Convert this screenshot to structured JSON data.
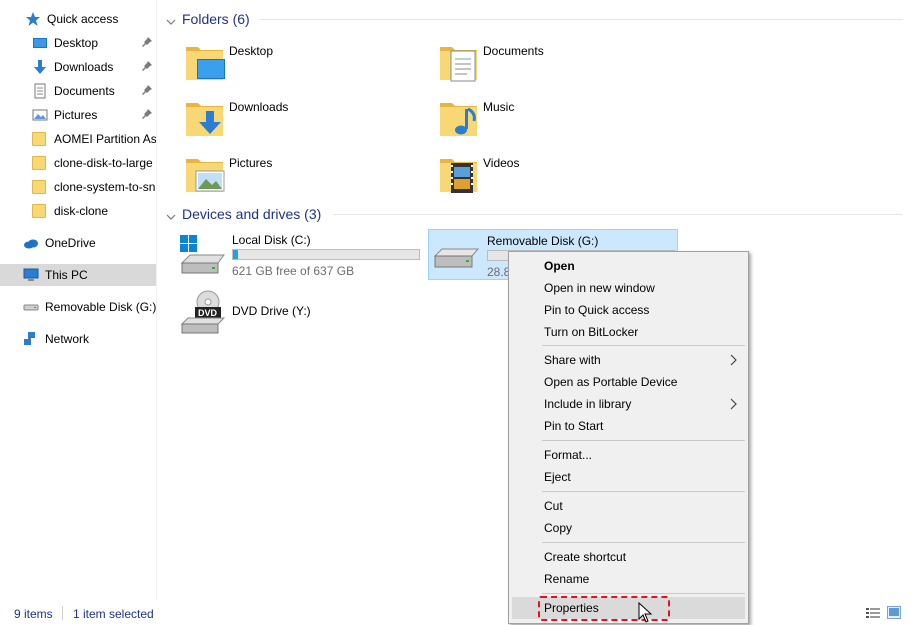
{
  "sidebar": {
    "quick_access": "Quick access",
    "items": [
      {
        "label": "Desktop",
        "pinned": true
      },
      {
        "label": "Downloads",
        "pinned": true
      },
      {
        "label": "Documents",
        "pinned": true
      },
      {
        "label": "Pictures",
        "pinned": true
      },
      {
        "label": "AOMEI Partition Ass"
      },
      {
        "label": "clone-disk-to-large"
      },
      {
        "label": "clone-system-to-sn"
      },
      {
        "label": "disk-clone"
      }
    ],
    "onedrive": "OneDrive",
    "this_pc": "This PC",
    "removable": "Removable Disk (G:)",
    "network": "Network"
  },
  "folders": {
    "header": "Folders (6)",
    "items": [
      "Desktop",
      "Documents",
      "Downloads",
      "Music",
      "Pictures",
      "Videos"
    ]
  },
  "devices": {
    "header": "Devices and drives (3)",
    "local": {
      "name": "Local Disk (C:)",
      "free": "621 GB free of 637 GB",
      "used_fraction": 0.025
    },
    "removable": {
      "name": "Removable Disk (G:)",
      "free": "28.8",
      "used_fraction": 0.0
    },
    "dvd": {
      "name": "DVD Drive (Y:)",
      "badge": "DVD"
    }
  },
  "context_menu": {
    "open": "Open",
    "open_new_window": "Open in new window",
    "pin_quick_access": "Pin to Quick access",
    "bitlocker": "Turn on BitLocker",
    "share_with": "Share with",
    "open_portable": "Open as Portable Device",
    "include_library": "Include in library",
    "pin_start": "Pin to Start",
    "format": "Format...",
    "eject": "Eject",
    "cut": "Cut",
    "copy": "Copy",
    "create_shortcut": "Create shortcut",
    "rename": "Rename",
    "properties": "Properties"
  },
  "status": {
    "items": "9 items",
    "selected": "1 item selected"
  },
  "colors": {
    "accent": "#1e3287",
    "selection": "#cce8ff",
    "highlight_box": "#e4131f",
    "folder": "#f8d775"
  }
}
